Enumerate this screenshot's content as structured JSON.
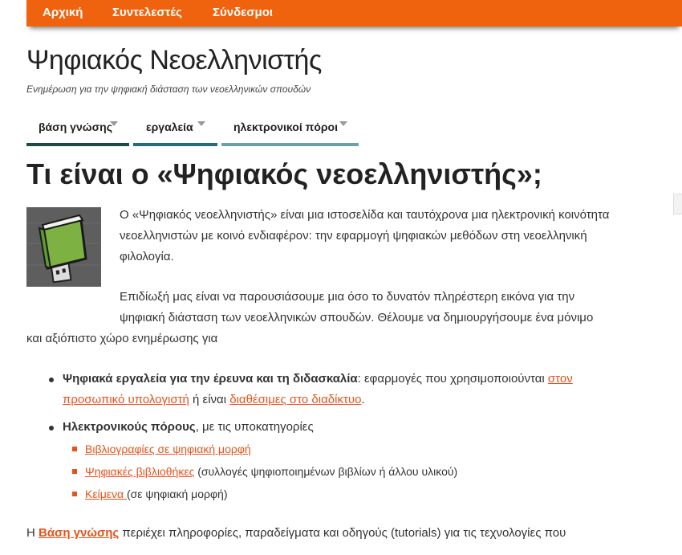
{
  "topnav": {
    "items": [
      {
        "label": "Αρχική"
      },
      {
        "label": "Συντελεστές"
      },
      {
        "label": "Σύνδεσμοι"
      }
    ]
  },
  "site": {
    "title": "Ψηφιακός Νεοελληνιστής",
    "description": "Ενημέρωση για την ψηφιακή διάσταση των νεοελληνικών σπουδών"
  },
  "secnav": {
    "items": [
      {
        "label": "βάση γνώσης",
        "color": "#1f4a46"
      },
      {
        "label": "εργαλεία",
        "color": "#2a6a78"
      },
      {
        "label": "ηλεκτρονικοί πόροι",
        "color": "#6fa0a6"
      }
    ]
  },
  "page": {
    "title": "Τι είναι ο «Ψηφιακός νεοελληνιστής»;",
    "intro1": "Ο «Ψηφιακός νεοελληνιστής» είναι μια ιστοσελίδα και ταυτόχρονα μια ηλεκτρονική κοινότητα νεοελληνιστών με κοινό ενδιαφέρον: την εφαρμογή ψηφιακών μεθόδων στη νεοελληνική φιλολογία.",
    "intro2_line1": "Επιδίωξή μας είναι να παρουσιάσουμε μια όσο το δυνατόν πληρέστερη εικόνα για την",
    "intro2_line2": "ψηφιακή διάσταση των νεοελληνικών σπουδών. Θέλουμε να δημιουργήσουμε ένα μόνιμο",
    "intro2_line3": "και αξιόπιστο χώρο ενημέρωσης για",
    "bullet1": {
      "bold": "Ψηφιακά εργαλεία για την έρευνα και τη διδασκαλία",
      "text1": ": εφαρμογές που χρησιμοποιούνται ",
      "link1": "στον προσωπικό υπολογιστή",
      "text2": " ή είναι ",
      "link2": "διαθέσιμες στο διαδίκτυο",
      "text3": "."
    },
    "bullet2": {
      "bold": "Ηλεκτρονικούς πόρους",
      "text": ", με τις υποκατηγορίες",
      "sub": [
        {
          "link": "Βιβλιογραφίες σε ψηφιακή μορφή",
          "text": ""
        },
        {
          "link": "Ψηφιακές βιβλιοθήκες",
          "text": " (συλλογές ψηφιοποιημένων βιβλίων ή άλλου υλικού)"
        },
        {
          "link": "Κείμενα ",
          "text": "(σε ψηφιακή μορφή)"
        }
      ]
    },
    "closing": {
      "pre": "Η ",
      "link": "Βάση γνώσης",
      "text": " περιέχει πληροφορίες, παραδείγματα και οδηγούς (tutorials)  για τις τεχνολογίες που"
    }
  },
  "colors": {
    "accent": "#f0630e",
    "link": "#e8521a",
    "thumb_book": "#7db243"
  }
}
